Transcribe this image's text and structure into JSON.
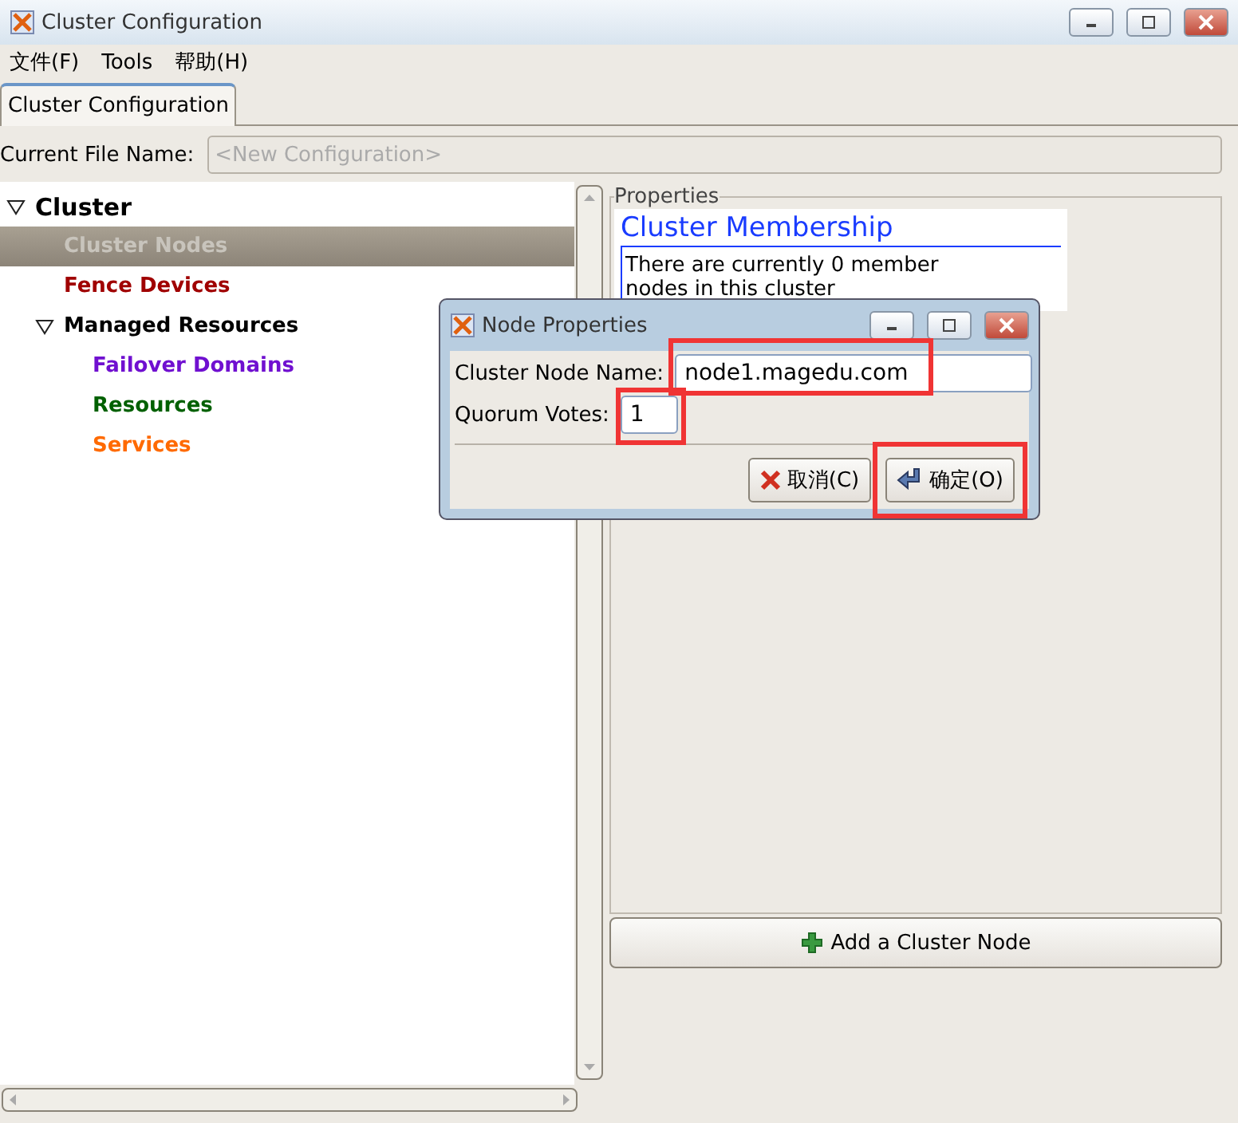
{
  "window": {
    "title": "Cluster Configuration"
  },
  "menu": [
    "文件(F)",
    "Tools",
    "帮助(H)"
  ],
  "tabs": [
    {
      "label": "Cluster Configuration",
      "selected": true
    }
  ],
  "file_name": {
    "label": "Current File Name:",
    "placeholder": "<New Configuration>"
  },
  "tree": [
    {
      "label": "Cluster",
      "expanded": true,
      "selected": false,
      "color": "#000000",
      "children": [
        {
          "label": "Cluster Nodes",
          "selected": true,
          "color": "#c8c4bc"
        },
        {
          "label": "Fence Devices",
          "selected": false,
          "color": "#a00000"
        },
        {
          "label": "Managed Resources",
          "expanded": true,
          "selected": false,
          "color": "#000000",
          "children": [
            {
              "label": "Failover Domains",
              "selected": false,
              "color": "#7010d0"
            },
            {
              "label": "Resources",
              "selected": false,
              "color": "#006000"
            },
            {
              "label": "Services",
              "selected": false,
              "color": "#ff6a00"
            }
          ]
        }
      ]
    }
  ],
  "properties": {
    "legend": "Properties",
    "heading": "Cluster Membership",
    "text": [
      "There are currently 0 member",
      "nodes in this cluster"
    ]
  },
  "add_button": "Add a Cluster Node",
  "dialog": {
    "title": "Node Properties",
    "fields": [
      {
        "label": "Cluster Node Name:",
        "value": "node1.magedu.com",
        "highlighted": true
      },
      {
        "label": "Quorum Votes:",
        "value": "1",
        "highlighted": true
      }
    ],
    "buttons": [
      {
        "label": "取消(C)",
        "kind": "cancel",
        "highlighted": false
      },
      {
        "label": "确定(O)",
        "kind": "ok",
        "highlighted": true
      }
    ]
  }
}
